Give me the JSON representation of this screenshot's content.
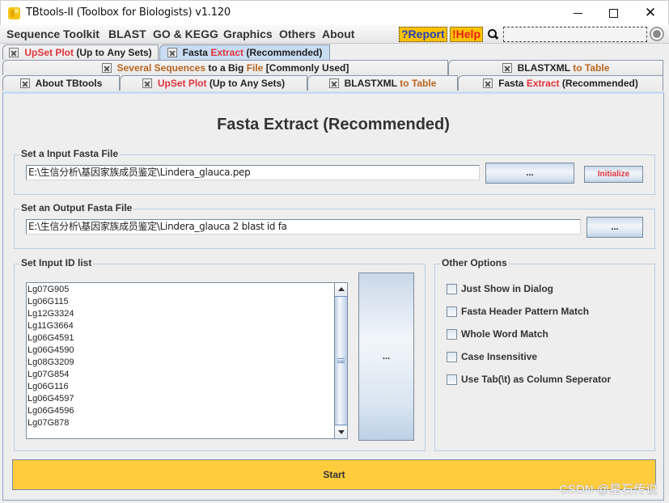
{
  "window": {
    "title": "TBtools-II (Toolbox for Biologists) v1.120",
    "minimize": "minimize",
    "maximize": "maximize",
    "close": "close"
  },
  "menu": {
    "items": [
      "Sequence Toolkit",
      "BLAST",
      "GO & KEGG",
      "Graphics",
      "Others",
      "About"
    ],
    "report": "?Report",
    "help": "!Help",
    "search_value": ""
  },
  "tabs": {
    "row1": [
      {
        "parts": [
          {
            "t": "UpSet Plot",
            "c": "red"
          },
          {
            "t": " (Up to Any Sets)",
            "c": "dark"
          }
        ],
        "selected": false
      },
      {
        "parts": [
          {
            "t": "Fasta ",
            "c": "dark"
          },
          {
            "t": "Extract",
            "c": "red"
          },
          {
            "t": " (Recommended)",
            "c": "dark"
          }
        ],
        "selected": true
      }
    ],
    "row2": [
      {
        "parts": [
          {
            "t": "Several Sequences",
            "c": "orange"
          },
          {
            "t": " to a Big ",
            "c": "dark"
          },
          {
            "t": "File",
            "c": "orange"
          },
          {
            "t": " [Commonly Used]",
            "c": "dark"
          }
        ]
      },
      {
        "parts": [
          {
            "t": "BLASTXML",
            "c": "dark"
          },
          {
            "t": " to Table",
            "c": "orange"
          }
        ]
      }
    ],
    "row3": [
      {
        "parts": [
          {
            "t": "About TBtools",
            "c": "dark"
          }
        ]
      },
      {
        "parts": [
          {
            "t": "UpSet Plot",
            "c": "red"
          },
          {
            "t": " (Up to Any Sets)",
            "c": "dark"
          }
        ]
      },
      {
        "parts": [
          {
            "t": "BLASTXML",
            "c": "dark"
          },
          {
            "t": " to Table",
            "c": "orange"
          }
        ]
      },
      {
        "parts": [
          {
            "t": "Fasta ",
            "c": "dark"
          },
          {
            "t": "Extract",
            "c": "red"
          },
          {
            "t": " (Recommended)",
            "c": "dark"
          }
        ]
      }
    ]
  },
  "panel": {
    "heading": "Fasta Extract (Recommended)",
    "input_group": {
      "legend": "Set a Input Fasta File",
      "value": "E:\\生信分析\\基因家族成员鉴定\\Lindera_glauca.pep",
      "browse_label": "...",
      "initialize_label": "Initialize"
    },
    "output_group": {
      "legend": "Set an Output Fasta File",
      "value": "E:\\生信分析\\基因家族成员鉴定\\Lindera_glauca 2 blast id fa",
      "browse_label": "..."
    },
    "id_group": {
      "legend": "Set Input ID list",
      "ids": [
        "Lg07G905",
        "Lg06G115",
        "Lg12G3324",
        "Lg11G3664",
        "Lg06G4591",
        "Lg06G4590",
        "Lg08G3209",
        "Lg07G854",
        "Lg06G116",
        "Lg06G4597",
        "Lg06G4596",
        "Lg07G878"
      ],
      "browse_label": "..."
    },
    "options_group": {
      "legend": "Other Options",
      "options": [
        {
          "label": "Just Show in Dialog",
          "checked": false
        },
        {
          "label": "Fasta Header Pattern Match",
          "checked": false
        },
        {
          "label": "Whole Word Match",
          "checked": false
        },
        {
          "label": "Case Insensitive",
          "checked": false
        },
        {
          "label": "Use Tab(\\t) as Column Seperator",
          "checked": false
        }
      ]
    },
    "start_label": "Start"
  },
  "watermark": "CSDN @星石传说",
  "colors": {
    "accent_yellow": "#ffcc3e",
    "badge_yellow": "#ffc200",
    "tab_selected": "#c9dcf1",
    "text_red": "#e0333c",
    "text_orange": "#b9651e",
    "report_blue": "#1f3fbf"
  }
}
